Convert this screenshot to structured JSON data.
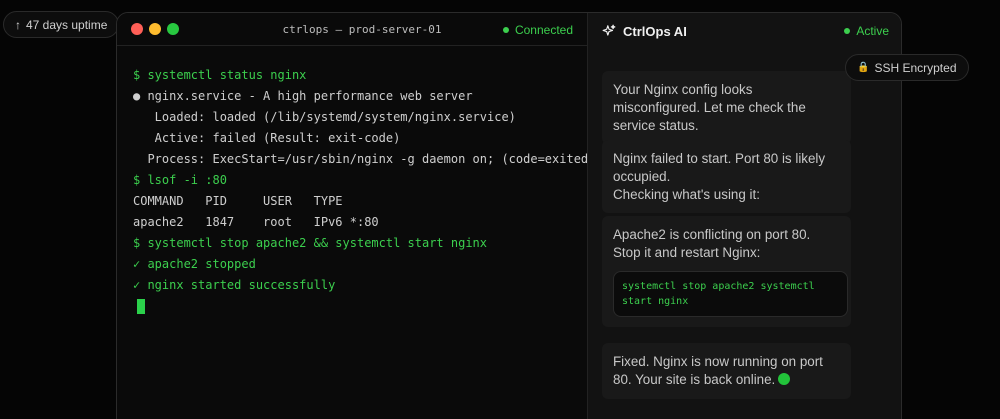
{
  "badges": {
    "uptime": {
      "icon": "arrow-up-icon",
      "glyph": "↑",
      "label": "47 days uptime"
    },
    "ssh": {
      "icon": "lock-icon",
      "glyph": "🔒",
      "label": "SSH Encrypted"
    }
  },
  "terminal": {
    "title": "ctrlops — prod-server-01",
    "status": "Connected",
    "lines": [
      {
        "kind": "cmd",
        "text": "$ systemctl status nginx"
      },
      {
        "kind": "out",
        "text": "● nginx.service - A high performance web server"
      },
      {
        "kind": "out",
        "text": "   Loaded: loaded (/lib/systemd/system/nginx.service)"
      },
      {
        "kind": "out",
        "text": "   Active: failed (Result: exit-code)"
      },
      {
        "kind": "out",
        "text": "  Process: ExecStart=/usr/sbin/nginx -g daemon on; (code=exited)"
      },
      {
        "kind": "cmd",
        "text": "$ lsof -i :80"
      },
      {
        "kind": "out",
        "text": "COMMAND   PID     USER   TYPE"
      },
      {
        "kind": "out",
        "text": "apache2   1847    root   IPv6 *:80"
      },
      {
        "kind": "cmd",
        "text": "$ systemctl stop apache2 && systemctl start nginx"
      },
      {
        "kind": "ok",
        "text": "✓ apache2 stopped"
      },
      {
        "kind": "ok",
        "text": "✓ nginx started successfully"
      }
    ]
  },
  "assistant": {
    "title": "CtrlOps AI",
    "icon": "sparkle-icon",
    "status": "Active",
    "messages": {
      "m1": "Your Nginx config looks misconfigured. Let me check the service status.",
      "m2": "Nginx failed to start. Port 80 is likely occupied.\nChecking what's using it:",
      "m3": "Apache2 is conflicting on port 80.\nStop it and restart Nginx:",
      "m3_code": "systemctl stop apache2 systemctl start nginx",
      "m4": "Fixed. Nginx is now running on port 80. Your site is back online."
    }
  },
  "colors": {
    "accent_green": "#3ccf4e",
    "background": "#050505",
    "panel": "#121212"
  }
}
